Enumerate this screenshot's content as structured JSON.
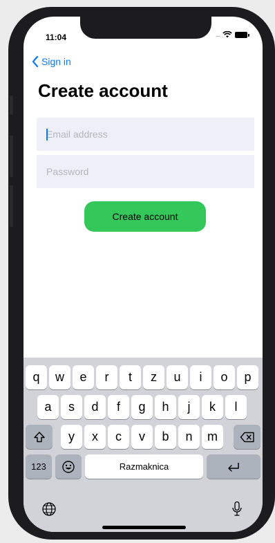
{
  "status": {
    "time": "11:04",
    "signal": "...."
  },
  "nav": {
    "back_label": "Sign in"
  },
  "page": {
    "title": "Create account"
  },
  "form": {
    "email_placeholder": "Email address",
    "password_placeholder": "Password",
    "submit_label": "Create account"
  },
  "colors": {
    "accent": "#0a7aff",
    "button": "#34c759",
    "field_bg": "#efeff7",
    "keyboard_bg": "#d1d3d9"
  },
  "keyboard": {
    "row1": [
      "q",
      "w",
      "e",
      "r",
      "t",
      "z",
      "u",
      "i",
      "o",
      "p"
    ],
    "row2": [
      "a",
      "s",
      "d",
      "f",
      "g",
      "h",
      "j",
      "k",
      "l"
    ],
    "row3": [
      "y",
      "x",
      "c",
      "v",
      "b",
      "n",
      "m"
    ],
    "numbers_label": "123",
    "space_label": "Razmaknica",
    "icons": {
      "shift": "shift-icon",
      "delete": "delete-icon",
      "emoji": "emoji-icon",
      "return": "return-icon",
      "globe": "globe-icon",
      "mic": "microphone-icon"
    }
  }
}
